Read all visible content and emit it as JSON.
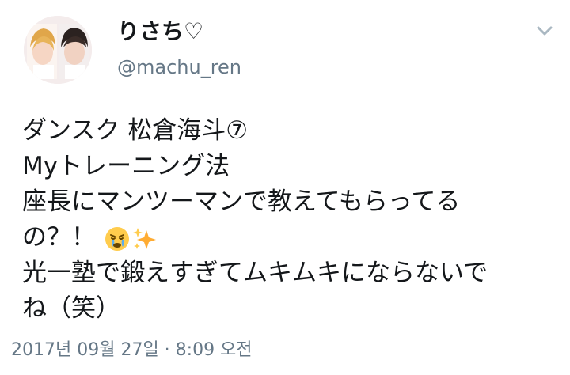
{
  "tweet": {
    "author": {
      "display_name": "りさち♡",
      "handle": "@machu_ren",
      "avatar_icon": "profile-avatar-icon"
    },
    "menu_icon": "chevron-down-icon",
    "text_lines": [
      "ダンスク 松倉海斗⑦",
      "Myトレーニング法",
      "座長にマンツーマンで教えてもらってる",
      "の？！",
      "光一塾で鍛えすぎてムキムキにならないで",
      "ね（笑）"
    ],
    "emojis": [
      "crying-face-emoji",
      "sparkles-emoji"
    ],
    "timestamp": "2017년 09월 27일 · 8:09 오전"
  },
  "colors": {
    "text": "#14171a",
    "secondary_text": "#657786",
    "caret": "#aab8c2",
    "emoji_face": "#ffcc4d",
    "sparkles": "#ffac33"
  }
}
